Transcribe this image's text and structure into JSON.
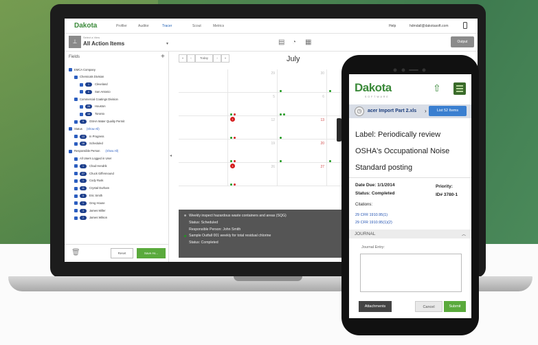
{
  "app": {
    "brand": "Dakota",
    "brand_sub": "SOFTWARE",
    "nav": [
      "Profiler",
      "Auditor",
      "Tracer",
      "Scout",
      "Metrics"
    ],
    "help": "Help",
    "user_email": "hdmdall@dakotasoft.com"
  },
  "view": {
    "label": "Select a View",
    "value": "All Action Items",
    "output_btn": "Output"
  },
  "fields_panel": {
    "title": "Fields",
    "tree": [
      {
        "indent": 0,
        "label": "EMCA Company"
      },
      {
        "indent": 1,
        "label": "Chemicals Division"
      },
      {
        "indent": 2,
        "pill": "1",
        "label": "Cleveland"
      },
      {
        "indent": 2,
        "pill": "0",
        "label": "San Antonio"
      },
      {
        "indent": 1,
        "label": "Commercial Coatings Division"
      },
      {
        "indent": 2,
        "pill": "28",
        "label": "Houston"
      },
      {
        "indent": 2,
        "pill": "18",
        "label": "Toronto"
      },
      {
        "indent": 1,
        "pill": "9",
        "label": "OSHA Water Quality Permit"
      },
      {
        "indent": 0,
        "label": "Status",
        "link": "(Show All)"
      },
      {
        "indent": 1,
        "pill": "13",
        "label": "In Progress"
      },
      {
        "indent": 1,
        "pill": "16",
        "label": "Scheduled"
      },
      {
        "indent": 0,
        "label": "Responsible Person",
        "link": "(Show All)"
      },
      {
        "indent": 1,
        "label": "All Users   Logged in User"
      },
      {
        "indent": 1,
        "pill": "1",
        "label": "Chad Hendrik"
      },
      {
        "indent": 1,
        "pill": "27",
        "label": "Chuck Giffennound"
      },
      {
        "indent": 1,
        "pill": "1",
        "label": "Cody Rusk"
      },
      {
        "indent": 1,
        "pill": "11",
        "label": "Crystal Durham"
      },
      {
        "indent": 1,
        "pill": "5",
        "label": "Eric Smith"
      },
      {
        "indent": 1,
        "pill": "1",
        "label": "Greg House"
      },
      {
        "indent": 1,
        "pill": "3",
        "label": "James Miller"
      },
      {
        "indent": 1,
        "pill": "2",
        "label": "James Wilson"
      }
    ],
    "reset_btn": "Reset",
    "saveas_btn": "Save As..."
  },
  "calendar": {
    "nav": [
      "«",
      "‹",
      "Today",
      "›",
      "»"
    ],
    "month": "July",
    "day_numbers": [
      "29",
      "30",
      "1",
      "2",
      "5",
      "6",
      "7",
      "8",
      "12",
      "13",
      "14",
      "15",
      "19",
      "20",
      "21",
      "22",
      "26",
      "27",
      "28",
      "29"
    ],
    "badge_a": "1",
    "badge_b": "1",
    "tooltip": [
      "Weekly inspect hazardous waste containers and areas (SQG)",
      "Status: Scheduled",
      "Responsible Person: John Smith",
      "Sample Outfall 001 weekly for total residual chlorine",
      "Status: Completed"
    ],
    "colors": {
      "green": "#1f9a1f",
      "red": "#d41b1b"
    }
  },
  "phone": {
    "brand": "Dakota",
    "brand_sub": "SOFTWARE",
    "import_text": "acer Import Part 2.xls",
    "list_btn": "List 52 Items",
    "label_lines": [
      "Label:  Periodically review",
      "OSHA's Occupational Noise",
      "Standard posting"
    ],
    "date_due": "Date Due: 1/1/2014",
    "status": "Status: Completed",
    "priority_label": "Priority:",
    "priority_id": "ID# 3780-1",
    "citations_label": "Citations:",
    "citations": [
      "29 CFR 1910.95(1)",
      "29 CFR 1910.95(1)(2)"
    ],
    "journal_header": "JOURNAL",
    "journal_entry": "Journal Entry:",
    "attach_btn": "Attachments",
    "cancel_btn": "Cancel",
    "submit_btn": "Submit"
  }
}
